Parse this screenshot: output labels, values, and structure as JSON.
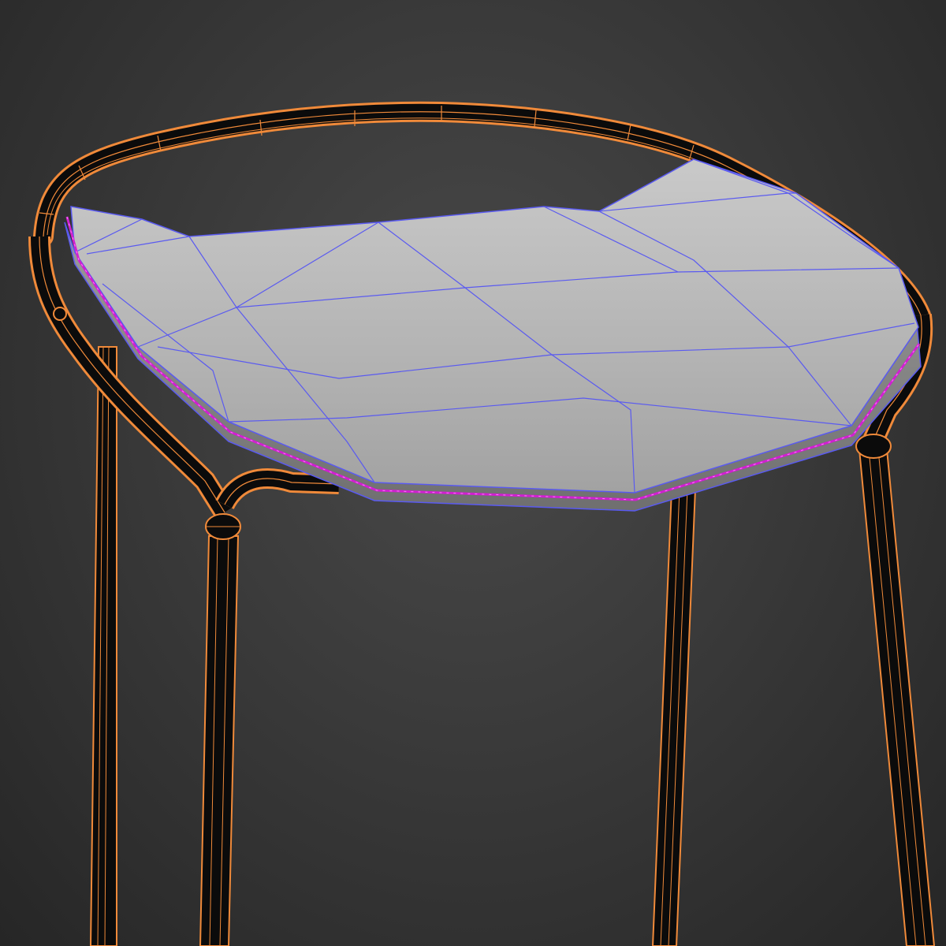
{
  "viewport": {
    "name": "3d-viewport-perspective",
    "background_top": "#3e3e3e",
    "background_bottom": "#262626"
  },
  "scene": {
    "object": "bar-stool",
    "parts": [
      {
        "id": "seat",
        "kind": "shaded-mesh",
        "label": ""
      },
      {
        "id": "frame",
        "kind": "wireframe",
        "label": ""
      }
    ]
  },
  "colors": {
    "frame_wire": "#f08a3a",
    "frame_fill": "#0b0b0b",
    "seat_shade": "#b9b9b9",
    "seat_edge_wire": "#5a5af0",
    "selection_edge": "#d020d0"
  }
}
